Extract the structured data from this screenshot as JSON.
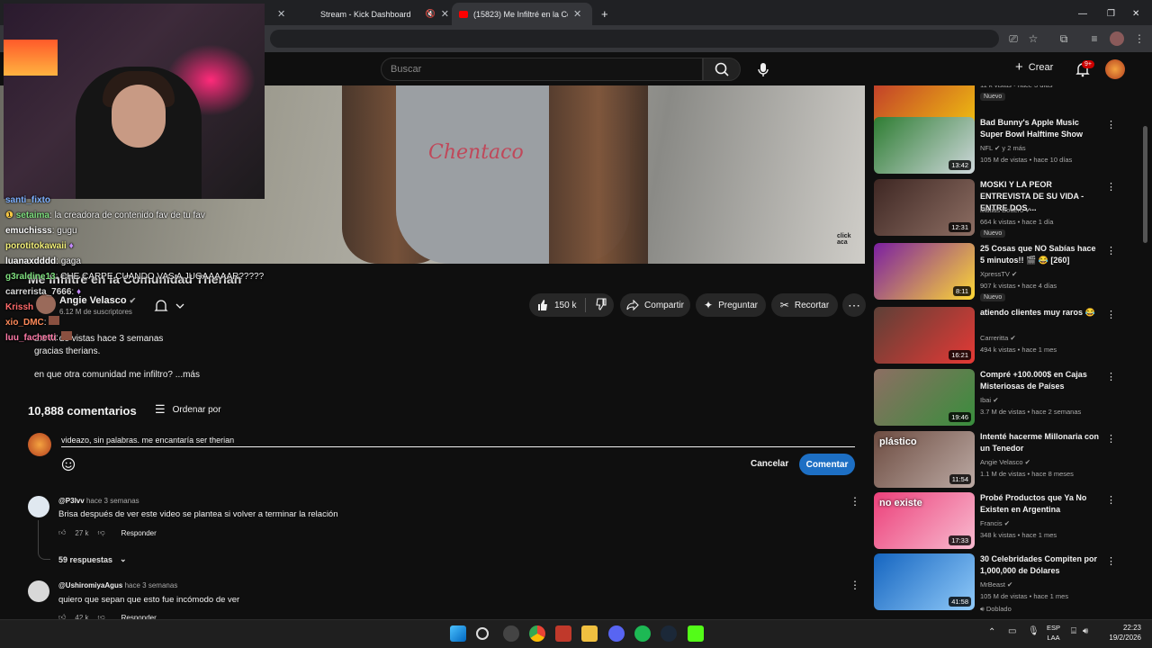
{
  "browser": {
    "tabs": [
      {
        "title": "Stream - Kick Dashboard"
      },
      {
        "title": "(15823) Me Infiltré en la Comun"
      }
    ],
    "new_tab": "+",
    "window_controls": {
      "minimize": "—",
      "maximize": "❐",
      "close": "✕"
    }
  },
  "youtube_header": {
    "search_placeholder": "Buscar",
    "create_label": "Crear",
    "notifications_badge": "9+"
  },
  "stream_chat": [
    {
      "user": "santi_fixto",
      "message": "",
      "color": "#7fb0ff"
    },
    {
      "user": "setaima",
      "message": "la creadora de contenido fav de tu fav",
      "color": "#7fe07f"
    },
    {
      "user": "emuchisss",
      "message": "gugu",
      "color": "#ffffff"
    },
    {
      "user": "porotitokawaii",
      "message": "",
      "color": "#f5f27a"
    },
    {
      "user": "luanaxdddd",
      "message": "gaga",
      "color": "#ffffff"
    },
    {
      "user": "g3raldine13",
      "message": "CHE CARPE CUANDO VAS A JUGAAAAAR?????",
      "color": "#7fe07f"
    },
    {
      "user": "carrerista_7666",
      "message": "",
      "color": "#d9d9d9"
    },
    {
      "user": "Krissh",
      "message": "",
      "color": "#ff6a6a"
    },
    {
      "user": "xio_DMC",
      "message": "",
      "color": "#ff8a5a"
    },
    {
      "user": "luu_fachetti",
      "message": "",
      "color": "#ff7aa8"
    }
  ],
  "video": {
    "title": "Me Infiltré en la Comunidad Therian",
    "shirt_text": "Chentaco",
    "watermark": "click aca",
    "channel_name": "Angie Velasco",
    "subscribers": "6.12 M de suscriptores",
    "likes": "150 k",
    "share_label": "Compartir",
    "ask_label": "Preguntar",
    "clip_label": "Recortar",
    "views_date": "2.8 M de vistas  hace 3 semanas",
    "description_line1": "gracias therians.",
    "description_line2": "en que otra comunidad me infiltro? ...más"
  },
  "comments_section": {
    "count_label": "10,888 comentarios",
    "sort_label": "Ordenar por",
    "draft_comment": "videazo, sin palabras. me encantaría ser therian",
    "cancel_label": "Cancelar",
    "comment_button": "Comentar",
    "reply_label": "Responder",
    "comments": [
      {
        "user": "@P3lvv",
        "time": "hace 3 semanas",
        "text": "Brisa después de ver este video se plantea si volver a terminar la relación",
        "likes": "27 k",
        "replies": "59 respuestas"
      },
      {
        "user": "@UshiromiyaAgus",
        "time": "hace 3 semanas",
        "text": "quiero que sepan que esto fue incómodo de ver",
        "likes": "42 k"
      }
    ]
  },
  "recommendations": [
    {
      "title": "",
      "channel": "",
      "meta": "11 k vistas • hace 3 días",
      "duration": "8:39",
      "badge": "Nuevo",
      "thumb_colors": [
        "#c0392b",
        "#f1c40f"
      ]
    },
    {
      "title": "Bad Bunny's Apple Music Super Bowl Halftime Show",
      "channel": "NFL",
      "meta": "105 M de vistas • hace 10 días",
      "extra": "y 2 más",
      "duration": "13:42",
      "thumb_colors": [
        "#2e7d32",
        "#cfd8dc"
      ]
    },
    {
      "title": "MOSKI Y LA PEOR ENTREVISTA DE SU VIDA - ENTRE DOS ...",
      "channel": "Matias Bottero",
      "meta": "664 k vistas • hace 1 día",
      "duration": "12:31",
      "badge": "Nuevo",
      "thumb_colors": [
        "#3e2723",
        "#8d6e63"
      ]
    },
    {
      "title": "25 Cosas que NO Sabías hace 5 minutos!! 🎬 😂 [260]",
      "channel": "XpressTV",
      "meta": "907 k vistas • hace 4 días",
      "duration": "8:11",
      "badge": "Nuevo",
      "thumb_colors": [
        "#7b1fa2",
        "#fdd835"
      ]
    },
    {
      "title": "atiendo clientes muy raros 😂",
      "channel": "Carreritta",
      "meta": "494 k vistas • hace 1 mes",
      "duration": "16:21",
      "thumb_colors": [
        "#5d4037",
        "#e53935"
      ]
    },
    {
      "title": "Compré +100.000$ en Cajas Misteriosas de Países",
      "channel": "Ibai",
      "meta": "3.7 M de vistas • hace 2 semanas",
      "duration": "19:46",
      "thumb_colors": [
        "#8d6e63",
        "#388e3c"
      ]
    },
    {
      "title": "Intenté hacerme Millonaria con un Tenedor",
      "channel": "Angie Velasco",
      "meta": "1.1 M de vistas • hace 8 meses",
      "duration": "11:54",
      "thumb_text": "plástico",
      "thumb_colors": [
        "#6d4c41",
        "#bcaaa4"
      ]
    },
    {
      "title": "Probé Productos que Ya No Existen en Argentina",
      "channel": "Francis",
      "meta": "348 k vistas • hace 1 mes",
      "duration": "17:33",
      "thumb_text": "no existe",
      "thumb_colors": [
        "#ec407a",
        "#f8bbd0"
      ]
    },
    {
      "title": "30 Celebridades Compiten por 1,000,000 de Dólares",
      "channel": "MrBeast",
      "meta": "105 M de vistas • hace 1 mes",
      "duration": "41:58",
      "badge2": "Doblado",
      "thumb_colors": [
        "#1565c0",
        "#90caf9"
      ]
    }
  ],
  "taskbar": {
    "lang_line1": "ESP",
    "lang_line2": "LAA",
    "time": "22:23",
    "date": "19/2/2026"
  }
}
